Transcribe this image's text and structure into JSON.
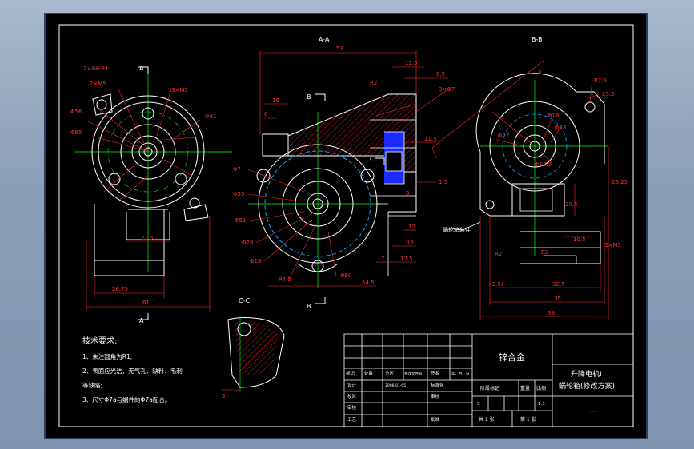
{
  "views": {
    "section_aa": "A-A",
    "section_bb": "B-B",
    "section_cc": "C-C",
    "cut_a": "A",
    "cut_b": "B",
    "cut_c": "C"
  },
  "dims_left": {
    "d1": "2×Φ6.81",
    "d2": "2×M5",
    "d3": "3×M5",
    "d4": "Φ56",
    "d5": "Φ65",
    "d6": "Φ41",
    "d7": "21.5",
    "d8": "26.75",
    "d9": "61"
  },
  "dims_mid": {
    "d1": "53",
    "d2": "12.5",
    "d3": "6.5",
    "d4": "3×Φ7",
    "d5": "R2",
    "d6": "16",
    "d7": "6",
    "d8": "11.5",
    "d9": "1.5",
    "d10": "Φ7",
    "d11": "Φ55",
    "d12": "Φ51",
    "d13": "Φ28",
    "d14": "Φ18",
    "d15": "R4.5",
    "d16": "Φ60",
    "d17": "54.5",
    "d18": "7",
    "d19": "17.5",
    "d20": "15",
    "d21": "12",
    "d22": "3"
  },
  "dims_right": {
    "d1": "R7.5",
    "d2": "25.5",
    "d3": "3",
    "d4": "Φ18",
    "d5": "Φ27",
    "d6": "Φ28",
    "d7": "Φ12.5",
    "d8": "26.25",
    "d9": "20.5",
    "d10": "10.5",
    "d11": "3×M5",
    "d12": "R2",
    "d13": "R2",
    "d14": "(2.5)",
    "d15": "32.5",
    "d16": "35",
    "d17": "39"
  },
  "callout": "蜗轮箱装件",
  "tech_requirements": {
    "title": "技术要求:",
    "line1": "1、未注圆角为R1;",
    "line2": "2、表面应光洁，无气孔、缺料、毛刺",
    "line3": "等缺陷;",
    "line4": "3、尺寸Φ7a与蜗件的Φ7a配合。"
  },
  "title_block": {
    "material": "锌合金",
    "name_line1": "升降电机Ⅰ",
    "name_line2": "蜗轮箱(修改方案)",
    "drawing_no": "—",
    "row_headers": [
      "标记",
      "处数",
      "分区",
      "更改文件号",
      "签名",
      "年、月、日"
    ],
    "design": "设计",
    "design_date": "2006-01-05",
    "standard": "标准化",
    "check": "校对",
    "process": "工艺",
    "review": "审核",
    "approve": "批准",
    "stage": "阶段标记",
    "weight": "重量",
    "scale": "比例",
    "scale_value": "1:1",
    "sheet_total": "共 1 张",
    "sheet_num": "第 1 张",
    "stage_s": "S"
  }
}
